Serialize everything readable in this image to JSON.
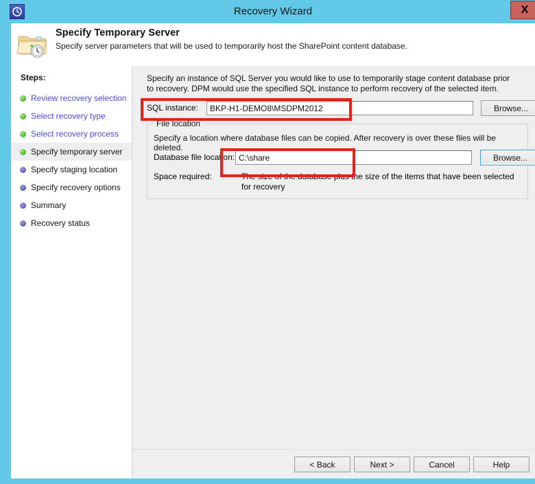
{
  "window": {
    "title": "Recovery Wizard",
    "app_icon": "recovery-clock-icon",
    "close_label": "X",
    "frame_color": "#63c9e8",
    "close_color": "#c9625c"
  },
  "header": {
    "icon": "folder-recovery-icon",
    "title": "Specify Temporary Server",
    "subtitle": "Specify server parameters that will be used to temporarily host the SharePoint content database."
  },
  "sidebar": {
    "title": "Steps:",
    "items": [
      {
        "label": "Review recovery selection",
        "state": "done",
        "bullet": "green-bullet-icon"
      },
      {
        "label": "Select recovery type",
        "state": "done",
        "bullet": "green-bullet-icon"
      },
      {
        "label": "Select recovery process",
        "state": "done",
        "bullet": "green-bullet-icon"
      },
      {
        "label": "Specify temporary server",
        "state": "current",
        "bullet": "green-bullet-icon"
      },
      {
        "label": "Specify staging location",
        "state": "pending",
        "bullet": "purple-bullet-icon"
      },
      {
        "label": "Specify recovery options",
        "state": "pending",
        "bullet": "purple-bullet-icon"
      },
      {
        "label": "Summary",
        "state": "pending",
        "bullet": "purple-bullet-icon"
      },
      {
        "label": "Recovery status",
        "state": "pending",
        "bullet": "purple-bullet-icon"
      }
    ]
  },
  "main": {
    "intro": "Specify an instance of SQL Server you would like to use to temporarily stage content database prior to recovery. DPM would use the specified SQL instance to perform recovery of the selected item.",
    "sql_instance": {
      "label": "SQL instance:",
      "value": "BKP-H1-DEMO8\\MSDPM2012",
      "placeholder": "",
      "browse_label": "Browse..."
    },
    "file_location": {
      "legend": "File location",
      "description": "Specify a location where database files can be copied. After recovery is over these files will be deleted.",
      "database_file_location": {
        "label": "Database file location:",
        "value": "C:\\share",
        "placeholder": "",
        "browse_label": "Browse..."
      },
      "space_required": {
        "label": "Space required:",
        "value": "The size of the database plus the size of the items that have been selected for recovery"
      }
    }
  },
  "footer": {
    "buttons": [
      {
        "label": "< Back"
      },
      {
        "label": "Next >"
      },
      {
        "label": "Cancel"
      },
      {
        "label": "Help"
      }
    ]
  },
  "annotations": {
    "highlight_color": "#e8201a",
    "boxes": [
      {
        "name": "sql-instance-highlight"
      },
      {
        "name": "database-file-location-highlight"
      }
    ]
  }
}
